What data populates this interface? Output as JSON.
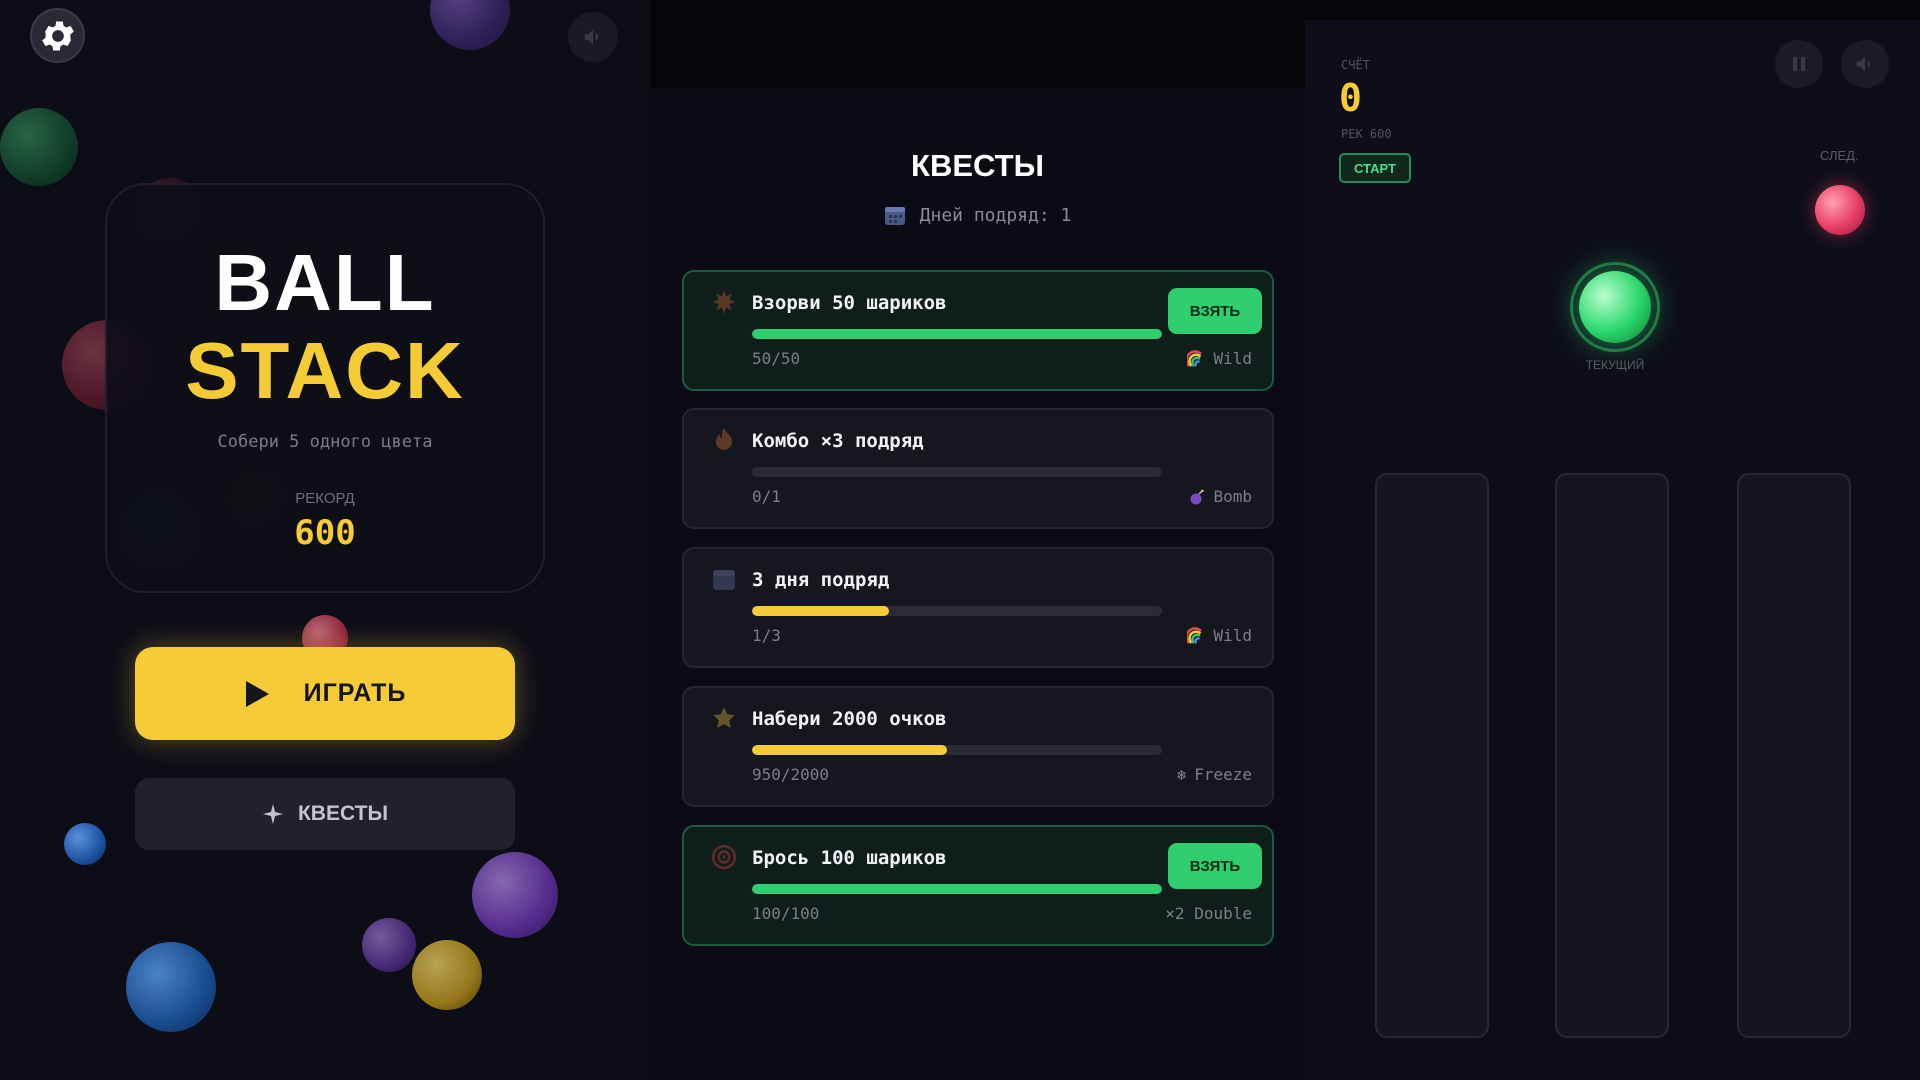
{
  "menu": {
    "title_line1": "BALL",
    "title_line2": "STACK",
    "subtitle": "Собери 5 одного цвета",
    "record_label": "РЕКОРД",
    "record_value": "600",
    "play_label": "ИГРАТЬ",
    "quests_label": "КВЕСТЫ",
    "icons": {
      "settings": "gear-icon",
      "sound": "speaker-icon",
      "play": "play-icon",
      "quests": "sparkle-icon"
    }
  },
  "quests": {
    "title": "КВЕСТЫ",
    "streak_text": "Дней подряд: 1",
    "items": [
      {
        "title": "Взорви 50 шариков",
        "progress_text": "50/50",
        "progress": 1.0,
        "reward": "Wild",
        "reward_icon": "rainbow-icon",
        "icon": "explosion-icon",
        "completed": true,
        "claim_label": "ВЗЯТЬ",
        "bar_color": "#2fcf6f"
      },
      {
        "title": "Комбо ×3 подряд",
        "progress_text": "0/1",
        "progress": 0.0,
        "reward": "Bomb",
        "reward_icon": "bomb-icon",
        "icon": "fire-icon",
        "completed": false,
        "bar_color": "#f5cc35"
      },
      {
        "title": "3 дня подряд",
        "progress_text": "1/3",
        "progress": 0.333,
        "reward": "Wild",
        "reward_icon": "rainbow-icon",
        "icon": "calendar-icon",
        "completed": false,
        "bar_color": "#f5cc35"
      },
      {
        "title": "Набери 2000 очков",
        "progress_text": "950/2000",
        "progress": 0.475,
        "reward": "Freeze",
        "reward_icon": "snowflake-icon",
        "icon": "star-icon",
        "completed": false,
        "bar_color": "#f5cc35"
      },
      {
        "title": "Брось 100 шариков",
        "progress_text": "100/100",
        "progress": 1.0,
        "reward": "×2 Double",
        "reward_icon": "",
        "icon": "target-icon",
        "completed": true,
        "claim_label": "ВЗЯТЬ",
        "bar_color": "#2fcf6f"
      }
    ]
  },
  "game": {
    "score_label": "СЧЁТ",
    "score_value": "0",
    "best_label": "РЕК 600",
    "start_label": "СТАРТ",
    "next_label": "СЛЕД.",
    "current_label": "ТЕКУЩИЙ",
    "next_ball_color": "#e83c63",
    "current_ball_color": "#28d66a",
    "icons": {
      "pause": "pause-icon",
      "sound": "speaker-icon"
    }
  },
  "colors": {
    "accent_yellow": "#f5cc35",
    "accent_green": "#2fcf6f",
    "background": "#0b0b14"
  }
}
